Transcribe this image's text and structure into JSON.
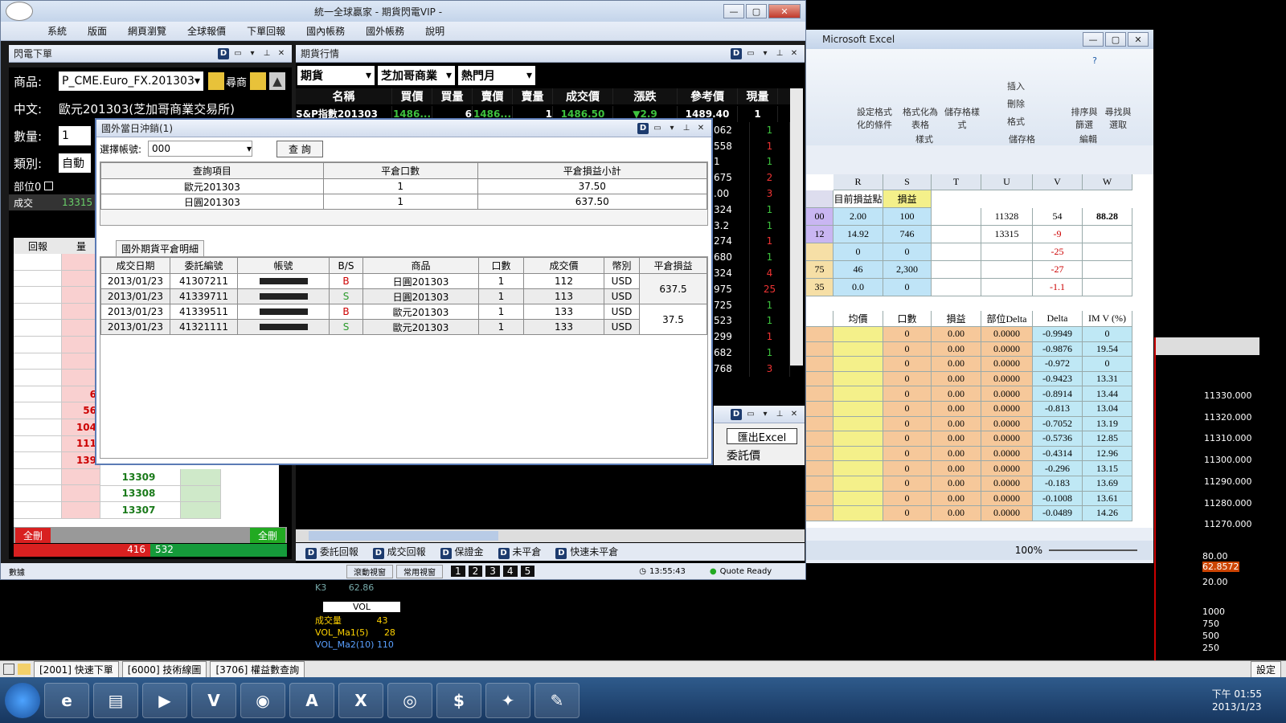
{
  "main_window": {
    "title": "統一全球贏家 - 期貨閃電VIP -",
    "menu": [
      "系統",
      "版面",
      "網頁瀏覽",
      "全球報價",
      "下單回報",
      "國內帳務",
      "國外帳務",
      "說明"
    ]
  },
  "order_panel": {
    "title": "閃電下單",
    "product_label": "商品:",
    "product_value": "P_CME.Euro_FX.201303",
    "search_label": "尋商",
    "chinese_label": "中文:",
    "chinese_value": "歐元201303(芝加哥商業交易所)",
    "qty_label": "數量:",
    "qty_value": "1",
    "type_label": "類別:",
    "type_value": "自動",
    "position_label": "部位0",
    "trade_label": "成交",
    "trade_value": "13315",
    "col_report": "回報",
    "col_qty": "量",
    "qty_cells": [
      "",
      "",
      "",
      "",
      "",
      "",
      "",
      "",
      "6",
      "56",
      "104",
      "111",
      "139",
      "",
      "",
      ""
    ],
    "prices": [
      "13309",
      "13308",
      "13307"
    ],
    "delete_all_left": "全刪",
    "delete_all_right": "全刪",
    "bottom_left": "416",
    "bottom_right": "532"
  },
  "quote_panel": {
    "title": "期貨行情",
    "sel1": "期貨",
    "sel2": "芝加哥商業",
    "sel3": "熱門月",
    "headers": [
      "名稱",
      "買價",
      "買量",
      "賣價",
      "賣量",
      "成交價",
      "漲跌",
      "參考價",
      "現量"
    ],
    "first_row": {
      "name": "S&P指數201303",
      "bid": "1486...",
      "bidq": "6",
      "ask": "1486...",
      "askq": "1",
      "last": "1486.50",
      "chg": "▼2.9",
      "ref": "1489.40",
      "vol": "1"
    },
    "ref_col": [
      "062",
      "558",
      "1",
      "675",
      ".00",
      "324",
      "3.2",
      "274",
      "680",
      "324",
      "975",
      "725",
      "523",
      "299",
      "682",
      "768"
    ],
    "vol_col": [
      "1",
      "1",
      "1",
      "2",
      "3",
      "1",
      "1",
      "1",
      "1",
      "4",
      "25",
      "1",
      "1",
      "1",
      "1",
      "3"
    ],
    "sub_title_export": "匯出Excel",
    "sub_label": "委託價",
    "bottom_tabs": [
      "委託回報",
      "成交回報",
      "保證金",
      "未平倉",
      "快速未平倉"
    ],
    "status_left": "數據",
    "status_btn1": "滾動視窗",
    "status_btn2": "常用視窗",
    "status_nums": [
      "1",
      "2",
      "3",
      "4",
      "5"
    ],
    "status_time": "13:55:43",
    "status_ready": "Quote Ready"
  },
  "dialog": {
    "title": "國外當日沖銷(1)",
    "account_label": "選擇帳號:",
    "account_value": "000",
    "query_btn": "查 詢",
    "summary_headers": [
      "查詢項目",
      "平倉口數",
      "平倉損益小計"
    ],
    "summary_rows": [
      [
        "歐元201303",
        "1",
        "37.50"
      ],
      [
        "日圓201303",
        "1",
        "637.50"
      ]
    ],
    "detail_tab": "國外期貨平倉明細",
    "detail_headers": [
      "成交日期",
      "委託編號",
      "帳號",
      "B/S",
      "商品",
      "口數",
      "成交價",
      "幣別",
      "平倉損益"
    ],
    "detail_rows": [
      {
        "date": "2013/01/23",
        "id": "41307211",
        "bs": "B",
        "product": "日圓201303",
        "qty": "1",
        "price": "112",
        "cur": "USD"
      },
      {
        "date": "2013/01/23",
        "id": "41339711",
        "bs": "S",
        "product": "日圓201303",
        "qty": "1",
        "price": "113",
        "cur": "USD"
      },
      {
        "date": "2013/01/23",
        "id": "41339511",
        "bs": "B",
        "product": "歐元201303",
        "qty": "1",
        "price": "133",
        "cur": "USD"
      },
      {
        "date": "2013/01/23",
        "id": "41321111",
        "bs": "S",
        "product": "歐元201303",
        "qty": "1",
        "price": "133",
        "cur": "USD"
      }
    ],
    "pnl_yen": "637.5",
    "pnl_euro": "37.5"
  },
  "excel": {
    "title": "Microsoft Excel",
    "ribbon": [
      "設定格式化的條件",
      "格式化為表格",
      "儲存格樣式"
    ],
    "ribbon_right": [
      "插入",
      "刪除",
      "格式"
    ],
    "ribbon_far": [
      "排序與篩選",
      "尋找與選取"
    ],
    "groups": [
      "樣式",
      "儲存格",
      "編輯"
    ],
    "cols": [
      "R",
      "S",
      "T",
      "U",
      "V",
      "W"
    ],
    "hdr1": "目前損益點",
    "hdr2": "損益",
    "top_rows": [
      [
        "2.00",
        "100",
        "",
        "11328",
        "54",
        "88.28"
      ],
      [
        "14.92",
        "746",
        "",
        "13315",
        "-9",
        ""
      ],
      [
        "0",
        "0",
        "",
        "",
        "-25",
        ""
      ],
      [
        "46",
        "2,300",
        "",
        "",
        "-27",
        ""
      ],
      [
        "0.0",
        "0",
        "",
        "",
        "-1.1",
        ""
      ]
    ],
    "left_stub": [
      "00",
      "12",
      "",
      "75",
      "35"
    ],
    "hdr_row2": [
      "均價",
      "口數",
      "損益",
      "部位Delta",
      "Delta",
      "IM V (%)"
    ],
    "bottom_rows": [
      [
        "0",
        "0.00",
        "0.0000",
        "-0.9949",
        "0"
      ],
      [
        "0",
        "0.00",
        "0.0000",
        "-0.9876",
        "19.54"
      ],
      [
        "0",
        "0.00",
        "0.0000",
        "-0.972",
        "0"
      ],
      [
        "0",
        "0.00",
        "0.0000",
        "-0.9423",
        "13.31"
      ],
      [
        "0",
        "0.00",
        "0.0000",
        "-0.8914",
        "13.44"
      ],
      [
        "0",
        "0.00",
        "0.0000",
        "-0.813",
        "13.04"
      ],
      [
        "0",
        "0.00",
        "0.0000",
        "-0.7052",
        "13.19"
      ],
      [
        "0",
        "0.00",
        "0.0000",
        "-0.5736",
        "12.85"
      ],
      [
        "0",
        "0.00",
        "0.0000",
        "-0.4314",
        "12.96"
      ],
      [
        "0",
        "0.00",
        "0.0000",
        "-0.296",
        "13.15"
      ],
      [
        "0",
        "0.00",
        "0.0000",
        "-0.183",
        "13.69"
      ],
      [
        "0",
        "0.00",
        "0.0000",
        "-0.1008",
        "13.61"
      ],
      [
        "0",
        "0.00",
        "0.0000",
        "-0.0489",
        "14.26"
      ]
    ],
    "zoom": "100%"
  },
  "right_chart": {
    "prices": [
      "11330.000",
      "11320.000",
      "11310.000",
      "11300.000",
      "11290.000",
      "11280.000",
      "11270.000"
    ],
    "osc": [
      "80.00",
      "62.8572",
      "20.00"
    ],
    "vol": [
      "1000",
      "750",
      "500",
      "250"
    ]
  },
  "bottom_chart": {
    "k3": "K3",
    "k3_val": "62.86",
    "vol_tag": "VOL",
    "l1": "成交量",
    "v1": "43",
    "l2": "VOL_Ma1(5)",
    "v2": "28",
    "l3": "VOL_Ma2(10)",
    "v3": "110"
  },
  "app_tabs": [
    "[2001] 快速下單",
    "[6000] 技術線圖",
    "[3706] 權益數查詢"
  ],
  "app_tab_right": "設定",
  "tray": {
    "time": "下午 01:55",
    "date": "2013/1/23"
  },
  "taskbar_items": [
    "start",
    "ie",
    "explorer",
    "media",
    "vip",
    "app",
    "pdf",
    "excel",
    "chrome",
    "money",
    "app2",
    "paint"
  ]
}
